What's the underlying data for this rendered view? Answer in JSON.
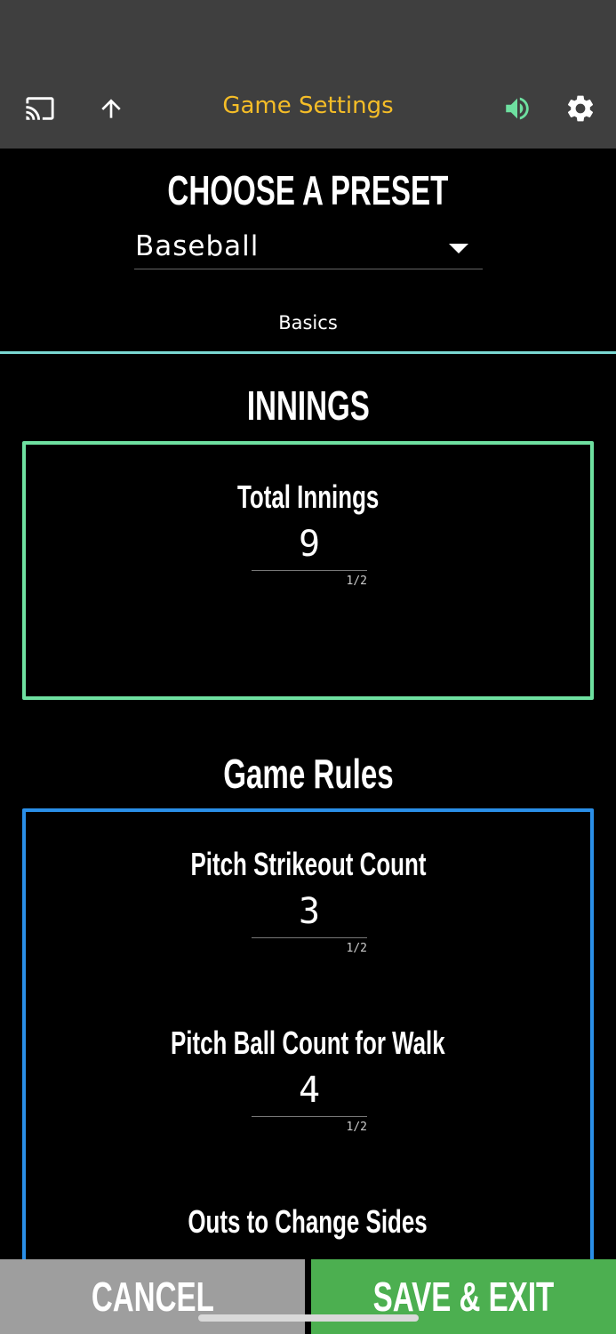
{
  "header": {
    "title": "Game Settings",
    "icons": {
      "cast": "cast-icon",
      "up": "arrow-up-icon",
      "sound": "volume-icon",
      "settings": "gear-icon"
    },
    "colors": {
      "title": "#f5bd27",
      "sound_icon": "#6ee0a0",
      "bar": "#3f3f3f"
    }
  },
  "preset": {
    "heading": "CHOOSE A PRESET",
    "selected": "Baseball"
  },
  "tabs": {
    "active": "Basics",
    "indicator_color": "#7ad8d2"
  },
  "innings": {
    "title": "INNINGS",
    "border_color": "#6ee0a0",
    "fields": [
      {
        "label": "Total Innings",
        "value": "9",
        "counter": "1/2"
      }
    ]
  },
  "rules": {
    "title": "Game Rules",
    "border_color": "#2a8fe8",
    "fields": [
      {
        "label": "Pitch Strikeout Count",
        "value": "3",
        "counter": "1/2"
      },
      {
        "label": "Pitch Ball Count for Walk",
        "value": "4",
        "counter": "1/2"
      },
      {
        "label": "Outs to Change Sides",
        "value": "",
        "counter": ""
      }
    ]
  },
  "actions": {
    "cancel": "CANCEL",
    "save": "SAVE & EXIT",
    "cancel_color": "#9e9e9e",
    "save_color": "#4caf50"
  }
}
